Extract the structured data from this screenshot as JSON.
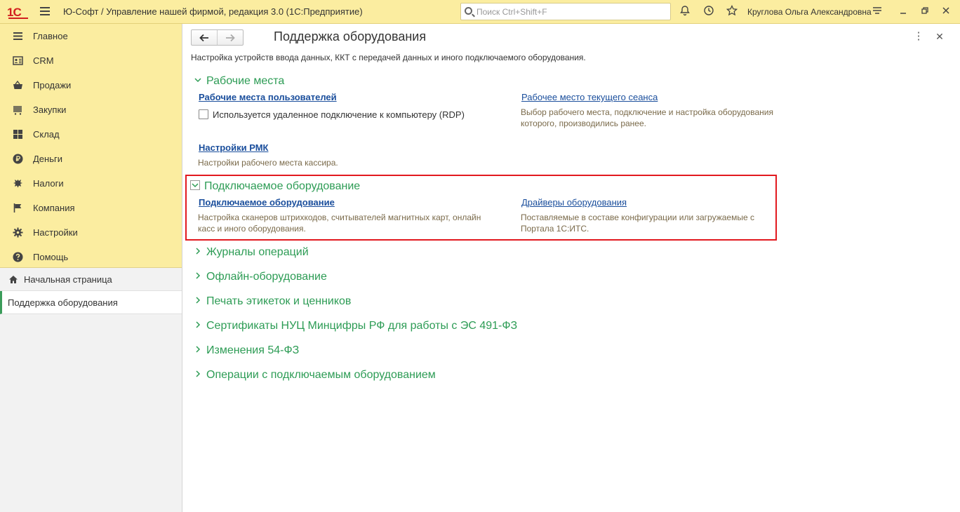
{
  "titlebar": {
    "logo": "1С",
    "app_title": "Ю-Софт / Управление нашей фирмой, редакция 3.0  (1С:Предприятие)",
    "search_placeholder": "Поиск Ctrl+Shift+F",
    "user_name": "Круглова Ольга Александровна"
  },
  "sidebar": {
    "menu": [
      {
        "label": "Главное",
        "icon": "list-icon"
      },
      {
        "label": "CRM",
        "icon": "contact-card-icon"
      },
      {
        "label": "Продажи",
        "icon": "basket-icon"
      },
      {
        "label": "Закупки",
        "icon": "barcode-cart-icon"
      },
      {
        "label": "Склад",
        "icon": "warehouse-grid-icon"
      },
      {
        "label": "Деньги",
        "icon": "ruble-coin-icon"
      },
      {
        "label": "Налоги",
        "icon": "eagle-icon"
      },
      {
        "label": "Компания",
        "icon": "flag-icon"
      },
      {
        "label": "Настройки",
        "icon": "gear-icon"
      },
      {
        "label": "Помощь",
        "icon": "help-icon"
      }
    ],
    "open_windows": [
      {
        "label": "Начальная страница"
      },
      {
        "label": "Поддержка оборудования"
      }
    ]
  },
  "main": {
    "title": "Поддержка оборудования",
    "description": "Настройка устройств ввода данных, ККТ с передачей данных и иного подключаемого оборудования.",
    "groups": {
      "workplaces": {
        "title": "Рабочие места",
        "user_workplaces_link": "Рабочие места пользователей",
        "rdp_label": "Используется удаленное подключение к компьютеру (RDP)",
        "current_session_link": "Рабочее место текущего сеанса",
        "current_session_desc": "Выбор рабочего места, подключение и настройка оборудования которого, производились ранее.",
        "rmk_link": "Настройки РМК",
        "rmk_desc": "Настройки рабочего места кассира."
      },
      "equipment": {
        "title": "Подключаемое оборудование",
        "equipment_link": "Подключаемое оборудование",
        "equipment_desc": "Настройка сканеров штрихкодов, считывателей магнитных карт, онлайн касс и иного оборудования.",
        "drivers_link": "Драйверы оборудования",
        "drivers_desc": "Поставляемые в составе конфигурации или загружаемые с Портала 1С:ИТС."
      },
      "collapsed": [
        "Журналы операций",
        "Офлайн-оборудование",
        "Печать этикеток и ценников",
        "Сертификаты НУЦ Минцифры РФ для работы с ЭС 491-ФЗ",
        "Изменения 54-ФЗ",
        "Операции с подключаемым оборудованием"
      ]
    }
  },
  "colors": {
    "accent_green": "#2d9c55",
    "link_blue": "#1a4e9c",
    "panel_yellow": "#fbeda0",
    "highlight_red": "#e2191f"
  }
}
